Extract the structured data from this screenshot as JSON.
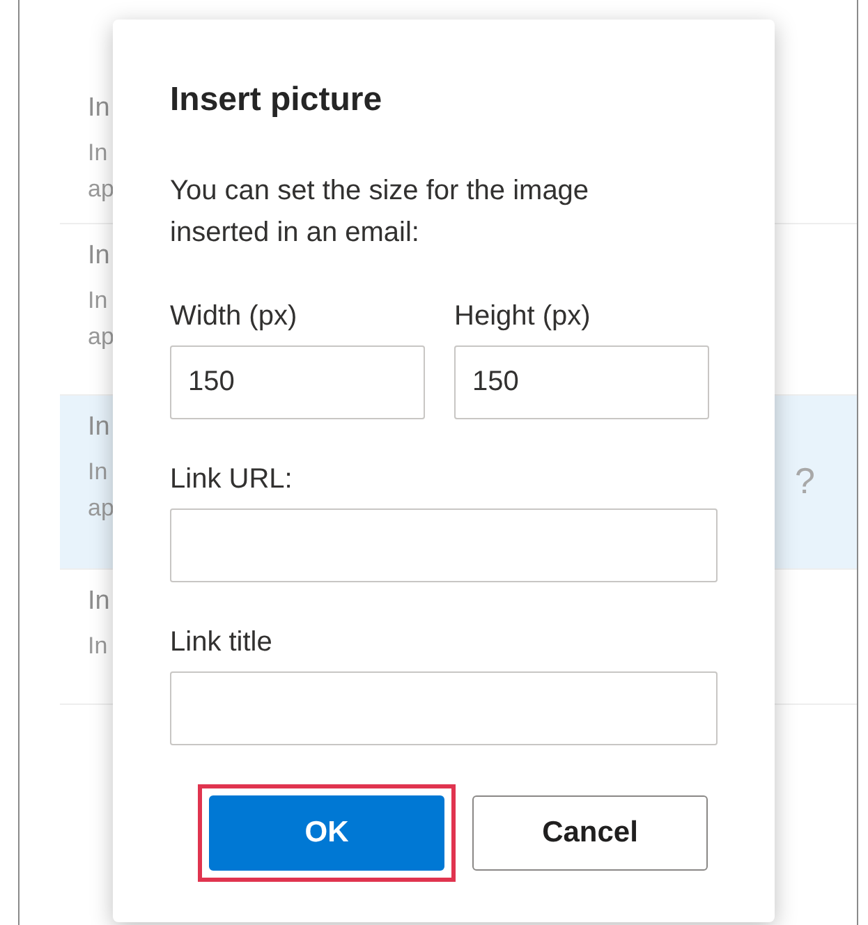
{
  "background_list": [
    {
      "title": "In",
      "lines": [
        "In",
        "ap"
      ],
      "selected": false
    },
    {
      "title": "In",
      "lines": [
        "In",
        "ap"
      ],
      "selected": false
    },
    {
      "title": "In",
      "lines": [
        "In",
        "ap"
      ],
      "selected": true,
      "trailing": "?"
    },
    {
      "title": "In",
      "lines": [
        "In"
      ],
      "selected": false
    }
  ],
  "dialog": {
    "title": "Insert picture",
    "description": "You can set the size for the image inserted in an email:",
    "width": {
      "label": "Width (px)",
      "value": "150"
    },
    "height": {
      "label": "Height (px)",
      "value": "150"
    },
    "link_url": {
      "label": "Link URL:"
    },
    "link_title": {
      "label": "Link title"
    },
    "buttons": [
      {
        "label": "OK",
        "kind": "primary",
        "focused": true
      },
      {
        "label": "Cancel",
        "kind": "secondary",
        "focused": false
      }
    ]
  }
}
